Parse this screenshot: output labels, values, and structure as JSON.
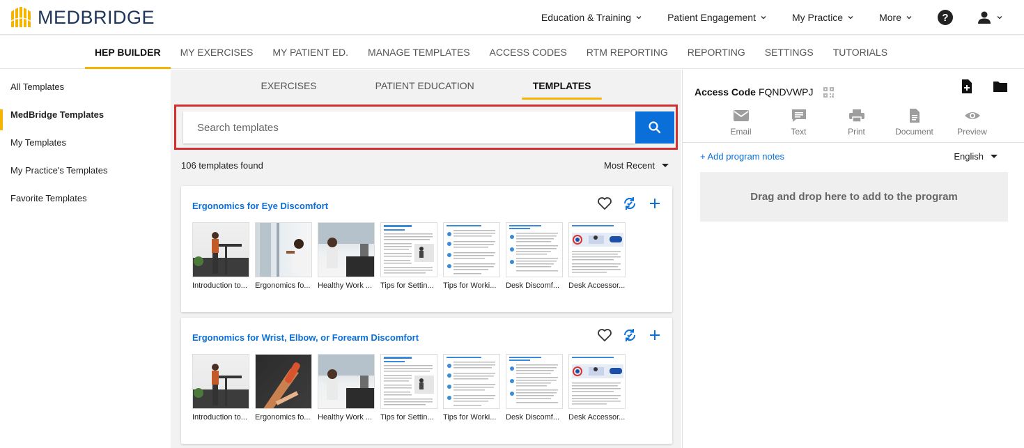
{
  "brand": {
    "name": "MEDBRIDGE",
    "accent": "#f4b400",
    "link_color": "#0a6fd8"
  },
  "topnav": {
    "items": [
      {
        "label": "Education & Training"
      },
      {
        "label": "Patient Engagement"
      },
      {
        "label": "My Practice"
      },
      {
        "label": "More"
      }
    ]
  },
  "subnav": {
    "items": [
      {
        "label": "HEP BUILDER",
        "active": true
      },
      {
        "label": "MY EXERCISES"
      },
      {
        "label": "MY PATIENT ED."
      },
      {
        "label": "MANAGE TEMPLATES"
      },
      {
        "label": "ACCESS CODES"
      },
      {
        "label": "RTM REPORTING"
      },
      {
        "label": "REPORTING"
      },
      {
        "label": "SETTINGS"
      },
      {
        "label": "TUTORIALS"
      }
    ]
  },
  "sidebar": {
    "items": [
      {
        "label": "All Templates"
      },
      {
        "label": "MedBridge Templates",
        "active": true
      },
      {
        "label": "My Templates"
      },
      {
        "label": "My Practice's Templates"
      },
      {
        "label": "Favorite Templates"
      }
    ]
  },
  "center": {
    "tabs": [
      {
        "label": "EXERCISES"
      },
      {
        "label": "PATIENT EDUCATION"
      },
      {
        "label": "TEMPLATES",
        "active": true
      }
    ],
    "search": {
      "placeholder": "Search templates",
      "value": ""
    },
    "results_count": "106 templates found",
    "sort_label": "Most Recent",
    "cards": [
      {
        "title": "Ergonomics for Eye Discomfort",
        "thumbs": [
          {
            "caption": "Introduction to..."
          },
          {
            "caption": "Ergonomics fo..."
          },
          {
            "caption": "Healthy Work ..."
          },
          {
            "caption": "Tips for Settin..."
          },
          {
            "caption": "Tips for Worki..."
          },
          {
            "caption": "Desk Discomf..."
          },
          {
            "caption": "Desk Accessor..."
          }
        ]
      },
      {
        "title": "Ergonomics for Wrist, Elbow, or Forearm Discomfort",
        "thumbs": [
          {
            "caption": "Introduction to..."
          },
          {
            "caption": "Ergonomics fo..."
          },
          {
            "caption": "Healthy Work ..."
          },
          {
            "caption": "Tips for Settin..."
          },
          {
            "caption": "Tips for Worki..."
          },
          {
            "caption": "Desk Discomf..."
          },
          {
            "caption": "Desk Accessor..."
          }
        ]
      }
    ]
  },
  "right_panel": {
    "access_label": "Access Code",
    "access_code": "FQNDVWPJ",
    "share": [
      {
        "label": "Email",
        "icon": "email-icon"
      },
      {
        "label": "Text",
        "icon": "message-icon"
      },
      {
        "label": "Print",
        "icon": "print-icon"
      },
      {
        "label": "Document",
        "icon": "document-icon"
      },
      {
        "label": "Preview",
        "icon": "eye-icon"
      }
    ],
    "add_notes": "+ Add program notes",
    "language": "English",
    "drop_zone": "Drag and drop here to add to the program"
  }
}
